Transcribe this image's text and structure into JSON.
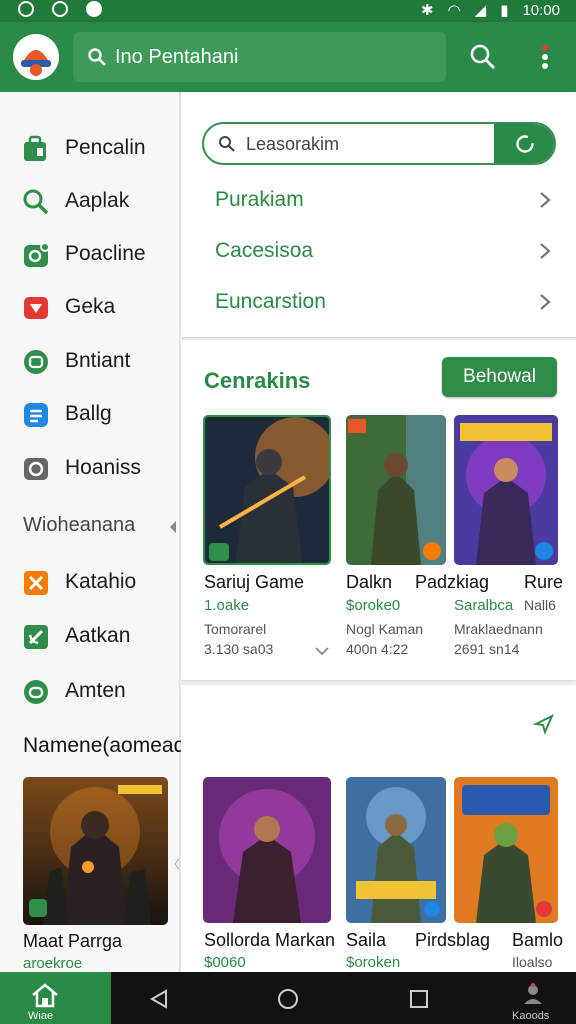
{
  "status_bar": {
    "time": "10:00"
  },
  "appbar": {
    "search_text": "Ino Pentahani"
  },
  "drawer": {
    "items": [
      {
        "label": "Pencalin"
      },
      {
        "label": "Aaplak"
      },
      {
        "label": "Poacline"
      },
      {
        "label": "Geka"
      },
      {
        "label": "Bntiant"
      },
      {
        "label": "Ballg"
      },
      {
        "label": "Hoaniss"
      }
    ],
    "section1": "Wioheanana",
    "items2": [
      {
        "label": "Katahio"
      },
      {
        "label": "Aatkan"
      },
      {
        "label": "Amten"
      }
    ],
    "section2": "Namene(aomead",
    "feature": {
      "title": "Maat Parrga",
      "subtitle": "aroekroe"
    }
  },
  "main": {
    "search_placeholder": "Leasorakim",
    "categories": [
      {
        "label": "Purakiam"
      },
      {
        "label": "Cacesisoa"
      },
      {
        "label": "Euncarstion"
      }
    ],
    "section1": {
      "title": "Cenrakins",
      "button": "Behowal",
      "cards": [
        {
          "title": "Sariuj Game",
          "price": "1.oake",
          "meta1": "Tomorarel",
          "meta2": "3.130 sa03"
        },
        {
          "title": "Dalkn",
          "price": "$oroke0",
          "meta1": "Nogl Kaman",
          "meta2": "400n 4:22"
        },
        {
          "title": "Padzkiag",
          "price": "Saralbca",
          "meta1": "Mraklaednann",
          "meta2": "2691 sn14"
        },
        {
          "title": "Rure",
          "price": "Nall6",
          "meta1": "",
          "meta2": ""
        }
      ]
    },
    "section2": {
      "cards": [
        {
          "title": "Sollorda Markan",
          "price": "$0060"
        },
        {
          "title": "Saila",
          "price": "$oroken"
        },
        {
          "title": "Pirdsblag",
          "price": ""
        },
        {
          "title": "Bamlo",
          "price": "Iloalso"
        }
      ]
    }
  },
  "navbar": {
    "home_label": "Wiae",
    "profile_label": "Kaoods"
  },
  "colors": {
    "primary": "#2a8a47",
    "appbar": "#2a8a47",
    "status": "#1f7a3b"
  }
}
